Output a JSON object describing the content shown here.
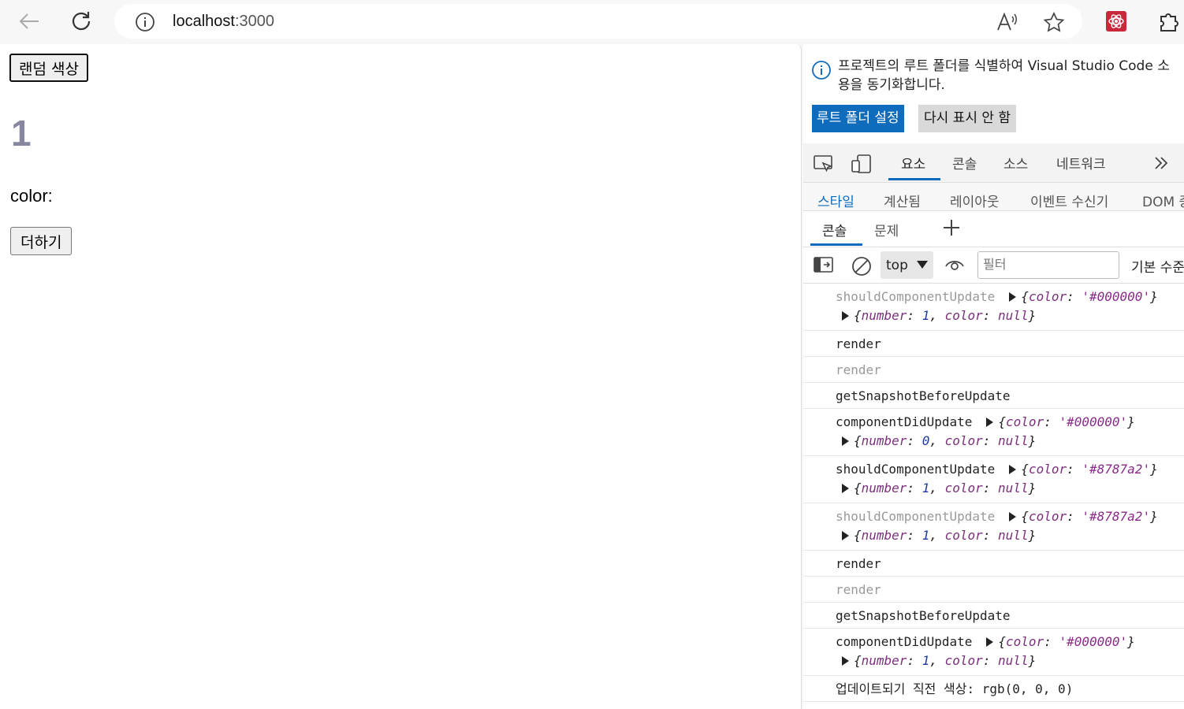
{
  "browser": {
    "url_host": "localhost",
    "url_port": ":3000"
  },
  "page": {
    "random_color_button": "랜덤 색상",
    "number": "1",
    "number_color": "#8787a2",
    "color_label": "color:",
    "add_button": "더하기"
  },
  "devtools": {
    "notice": {
      "message_line1": "프로젝트의 루트 폴더를 식별하여 Visual Studio Code 소",
      "message_line2": "용을 동기화합니다.",
      "primary_button": "루트 폴더 설정",
      "secondary_button": "다시 표시 안 함"
    },
    "main_tabs": [
      "요소",
      "콘솔",
      "소스",
      "네트워크"
    ],
    "sub_tabs": [
      "스타일",
      "계산됨",
      "레이아웃",
      "이벤트 수신기",
      "DOM 중"
    ],
    "drawer_tabs": [
      "콘솔",
      "문제"
    ],
    "toolbar": {
      "context": "top",
      "filter_placeholder": "필터",
      "levels": "기본 수준"
    },
    "console_rows": [
      {
        "label": "shouldComponentUpdate",
        "grey": true,
        "arg1": {
          "color": "'#000000'"
        },
        "arg2": {
          "number": "1",
          "color": "null"
        }
      },
      {
        "label": "render",
        "grey": false
      },
      {
        "label": "render",
        "grey": true
      },
      {
        "label": "getSnapshotBeforeUpdate",
        "grey": false
      },
      {
        "label": "componentDidUpdate",
        "grey": false,
        "arg1": {
          "color": "'#000000'"
        },
        "arg2": {
          "number": "0",
          "color": "null"
        }
      },
      {
        "label": "shouldComponentUpdate",
        "grey": false,
        "arg1": {
          "color": "'#8787a2'"
        },
        "arg2": {
          "number": "1",
          "color": "null"
        }
      },
      {
        "label": "shouldComponentUpdate",
        "grey": true,
        "arg1": {
          "color": "'#8787a2'"
        },
        "arg2": {
          "number": "1",
          "color": "null"
        }
      },
      {
        "label": "render",
        "grey": false
      },
      {
        "label": "render",
        "grey": true
      },
      {
        "label": "getSnapshotBeforeUpdate",
        "grey": false
      },
      {
        "label": "componentDidUpdate",
        "grey": false,
        "arg1": {
          "color": "'#000000'"
        },
        "arg2": {
          "number": "1",
          "color": "null"
        }
      },
      {
        "label": "업데이트되기 직전 색상: rgb(0, 0, 0)",
        "grey": false
      }
    ]
  }
}
